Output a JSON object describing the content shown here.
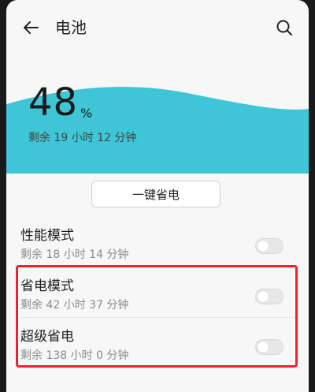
{
  "header": {
    "title": "电池",
    "back_icon": "arrow-left-icon",
    "search_icon": "search-icon"
  },
  "battery": {
    "percent": "48",
    "percent_sign": "%",
    "level_fraction": 0.48,
    "remaining": "剩余 19 小时 12 分钟",
    "wave_color": "#3ec5d6"
  },
  "one_key_button": {
    "label": "一键省电"
  },
  "modes": [
    {
      "title": "性能模式",
      "remaining": "剩余 18 小时 14 分钟",
      "enabled": false
    },
    {
      "title": "省电模式",
      "remaining": "剩余 42 小时 37 分钟",
      "enabled": false
    },
    {
      "title": "超级省电",
      "remaining": "剩余 138 小时 0 分钟",
      "enabled": false
    }
  ],
  "highlight_color": "#f0212a"
}
